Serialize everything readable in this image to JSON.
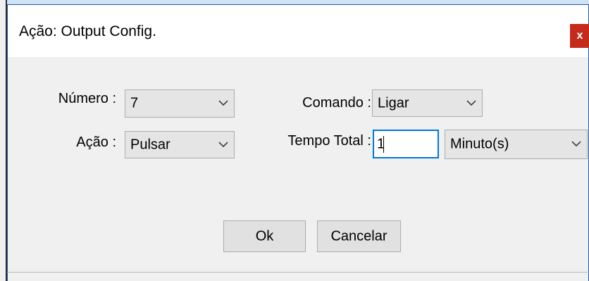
{
  "window": {
    "title": "Ação: Output Config.",
    "close_label": "x"
  },
  "form": {
    "numero": {
      "label": "Número :",
      "value": "7"
    },
    "comando": {
      "label": "Comando :",
      "value": "Ligar"
    },
    "acao": {
      "label": "Ação :",
      "value": "Pulsar"
    },
    "tempo_total": {
      "label": "Tempo Total :",
      "value": "1"
    },
    "unidade": {
      "value": "Minuto(s)"
    }
  },
  "buttons": {
    "ok": "Ok",
    "cancelar": "Cancelar"
  },
  "icons": {
    "dropdown": "chevron-down-icon",
    "close": "close-icon"
  },
  "colors": {
    "close_bg": "#c42b1c",
    "focus_border": "#0078d7",
    "dialog_bg": "#f0f0f0"
  }
}
